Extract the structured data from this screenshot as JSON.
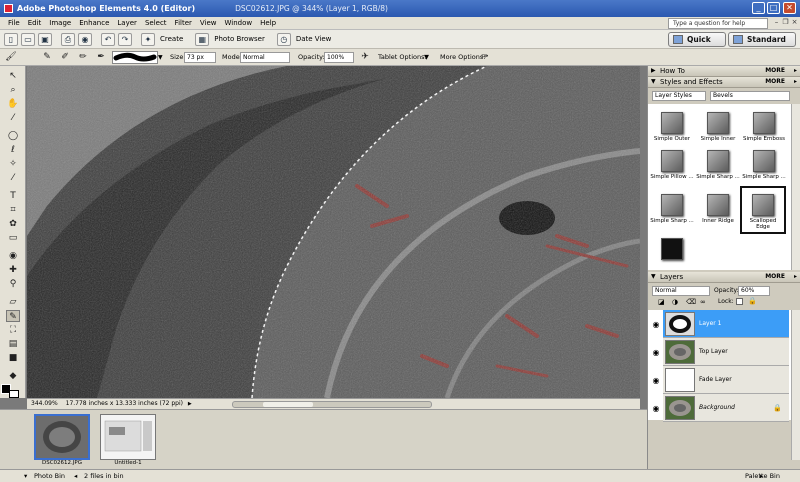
{
  "window": {
    "app_title": "Adobe Photoshop Elements 4.0 (Editor)",
    "doc_title": "DSC02612.JPG @ 344% (Layer 1, RGB/8)"
  },
  "menu": {
    "items": [
      "File",
      "Edit",
      "Image",
      "Enhance",
      "Layer",
      "Select",
      "Filter",
      "View",
      "Window",
      "Help"
    ],
    "help_placeholder": "Type a question for help"
  },
  "shortcuts": {
    "create": "Create",
    "photo_browser": "Photo Browser",
    "date_view": "Date View",
    "quick_fix": "Quick Fix",
    "standard_edit": "Standard Edit"
  },
  "options": {
    "size_label": "Size:",
    "size_value": "73 px",
    "mode_label": "Mode:",
    "mode_value": "Normal",
    "opacity_label": "Opacity:",
    "opacity_value": "100%",
    "tablet_options": "Tablet Options:",
    "more_options": "More Options:"
  },
  "status": {
    "zoom": "344.09%",
    "doc_info": "17.778 inches x 13.333 inches (72 ppi)"
  },
  "photo_bin": {
    "items": [
      {
        "label": "DSC02612.JPG",
        "selected": true
      },
      {
        "label": "Untitled-1",
        "selected": false
      }
    ],
    "bin_label": "Photo Bin",
    "file_count": "2 files in bin",
    "palette_bin": "Palette Bin"
  },
  "palettes": {
    "how_to": "How To",
    "styles_effects": "Styles and Effects",
    "more": "MORE",
    "style_category": "Layer Styles",
    "style_set": "Bevels",
    "styles": [
      "Simple Outer",
      "Simple Inner",
      "Simple Emboss",
      "Simple Pillow ...",
      "Simple Sharp ...",
      "Simple Sharp ...",
      "Simple Sharp ...",
      "Inner Ridge",
      "Scalloped Edge"
    ],
    "selected_style": "Scalloped Edge",
    "layers_title": "Layers",
    "blend_mode": "Normal",
    "opacity_label": "Opacity:",
    "opacity_value": "60%",
    "lock_label": "Lock:",
    "layers": [
      {
        "name": "Layer 1",
        "active": true
      },
      {
        "name": "Top Layer",
        "active": false
      },
      {
        "name": "Fade Layer",
        "active": false
      },
      {
        "name": "Background",
        "active": false
      }
    ]
  },
  "colors": {
    "accent": "#3c9df7",
    "title_bar": "#2b58b0",
    "chrome": "#e4e1d6"
  }
}
